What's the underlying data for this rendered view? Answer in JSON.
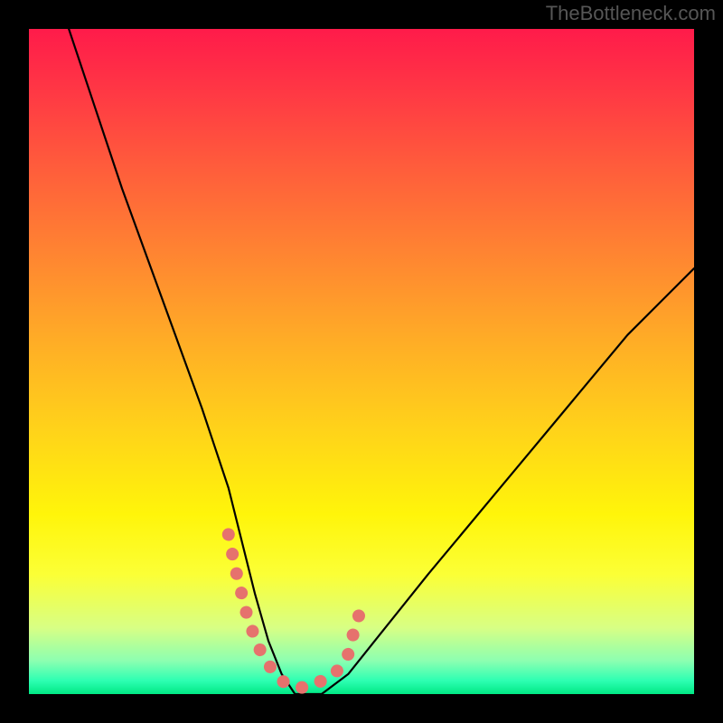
{
  "watermark": "TheBottleneck.com",
  "chart_data": {
    "type": "line",
    "title": "",
    "xlabel": "",
    "ylabel": "",
    "xlim": [
      0,
      100
    ],
    "ylim": [
      0,
      100
    ],
    "grid": false,
    "legend": false,
    "background_gradient": {
      "stops": [
        {
          "pos": 0.0,
          "color": "#ff1b4a"
        },
        {
          "pos": 0.2,
          "color": "#ff5a3c"
        },
        {
          "pos": 0.47,
          "color": "#ffad26"
        },
        {
          "pos": 0.73,
          "color": "#fff50a"
        },
        {
          "pos": 0.9,
          "color": "#d8ff84"
        },
        {
          "pos": 1.0,
          "color": "#00e884"
        }
      ]
    },
    "series": [
      {
        "name": "bottleneck-curve",
        "color": "#000000",
        "x": [
          6,
          10,
          14,
          18,
          22,
          26,
          28,
          30,
          32,
          34,
          36,
          38,
          40,
          42,
          44,
          48,
          52,
          56,
          60,
          65,
          70,
          75,
          80,
          85,
          90,
          95,
          100
        ],
        "y": [
          100,
          88,
          76,
          65,
          54,
          43,
          37,
          31,
          23,
          15,
          8,
          3,
          0,
          0,
          0,
          3,
          8,
          13,
          18,
          24,
          30,
          36,
          42,
          48,
          54,
          59,
          64
        ]
      },
      {
        "name": "optimal-range-marker",
        "color": "#e6726d",
        "marker": "round",
        "x": [
          30,
          31,
          33,
          35,
          37,
          38,
          40,
          42,
          44,
          46,
          48,
          49,
          50
        ],
        "y": [
          24,
          19,
          11,
          6,
          3,
          2,
          1,
          1,
          2,
          3,
          6,
          10,
          13
        ]
      }
    ],
    "minimum_x": 41
  }
}
